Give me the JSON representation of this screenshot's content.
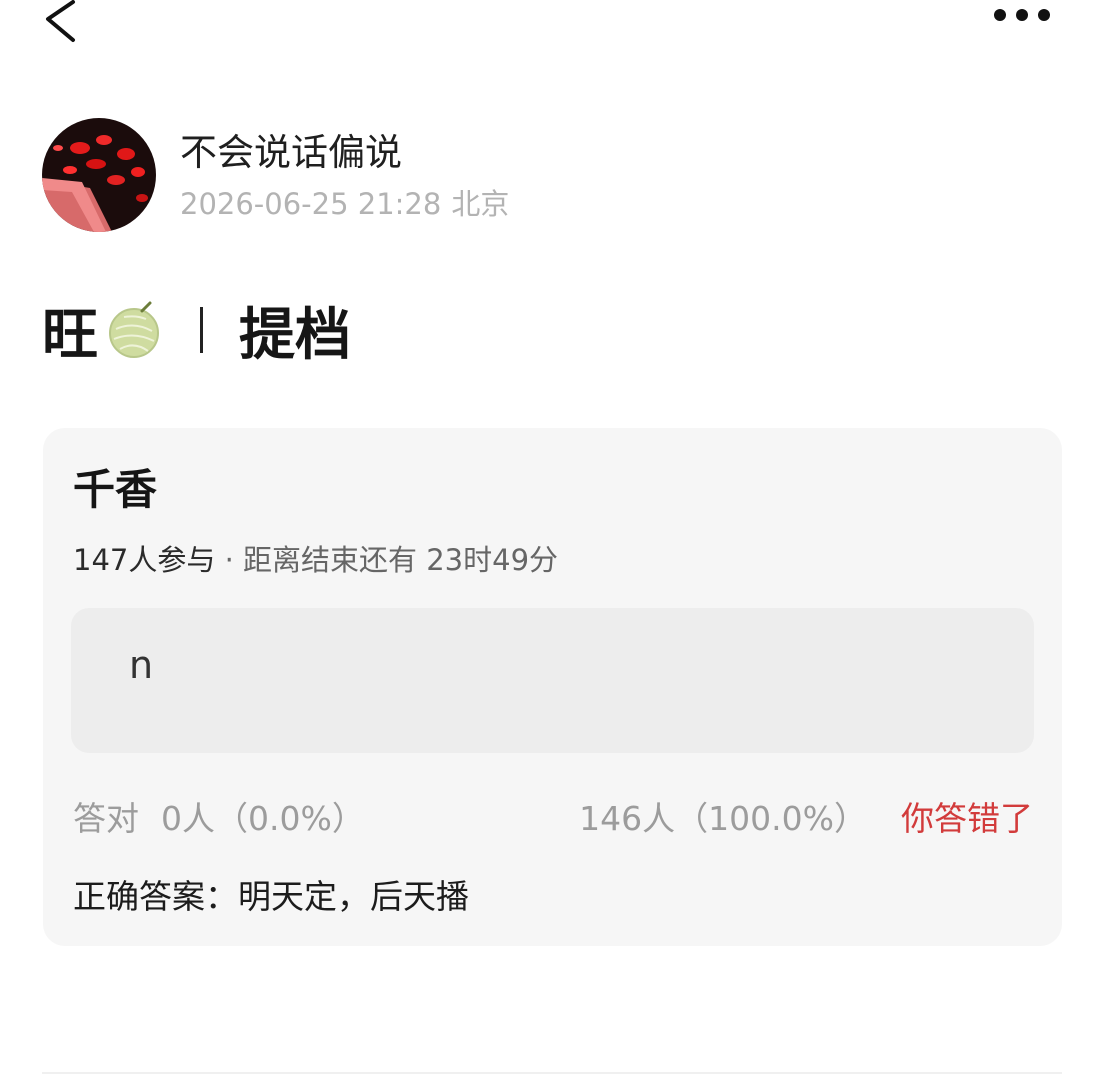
{
  "post": {
    "author_name": "不会说话偏说",
    "timestamp": "2026-06-25 21:28",
    "location": "北京",
    "title_part1": "旺",
    "title_part2": "提档"
  },
  "quiz": {
    "question": "千香",
    "participants": "147人参与",
    "time_left": "· 距离结束还有 23时49分",
    "my_answer": "n",
    "correct_label": "答对",
    "correct_stat": "0人（0.0%）",
    "wrong_stat": "146人（100.0%）",
    "wrong_badge": "你答错了",
    "correct_answer": "正确答案：明天定，后天播"
  },
  "icons": {
    "back": "chevron-left-icon",
    "more": "more-dots-icon",
    "emoji": "melon-emoji"
  },
  "colors": {
    "accent_wrong": "#d23b3b",
    "meta_gray": "#b3b3b3",
    "card_bg": "#f6f6f6"
  }
}
